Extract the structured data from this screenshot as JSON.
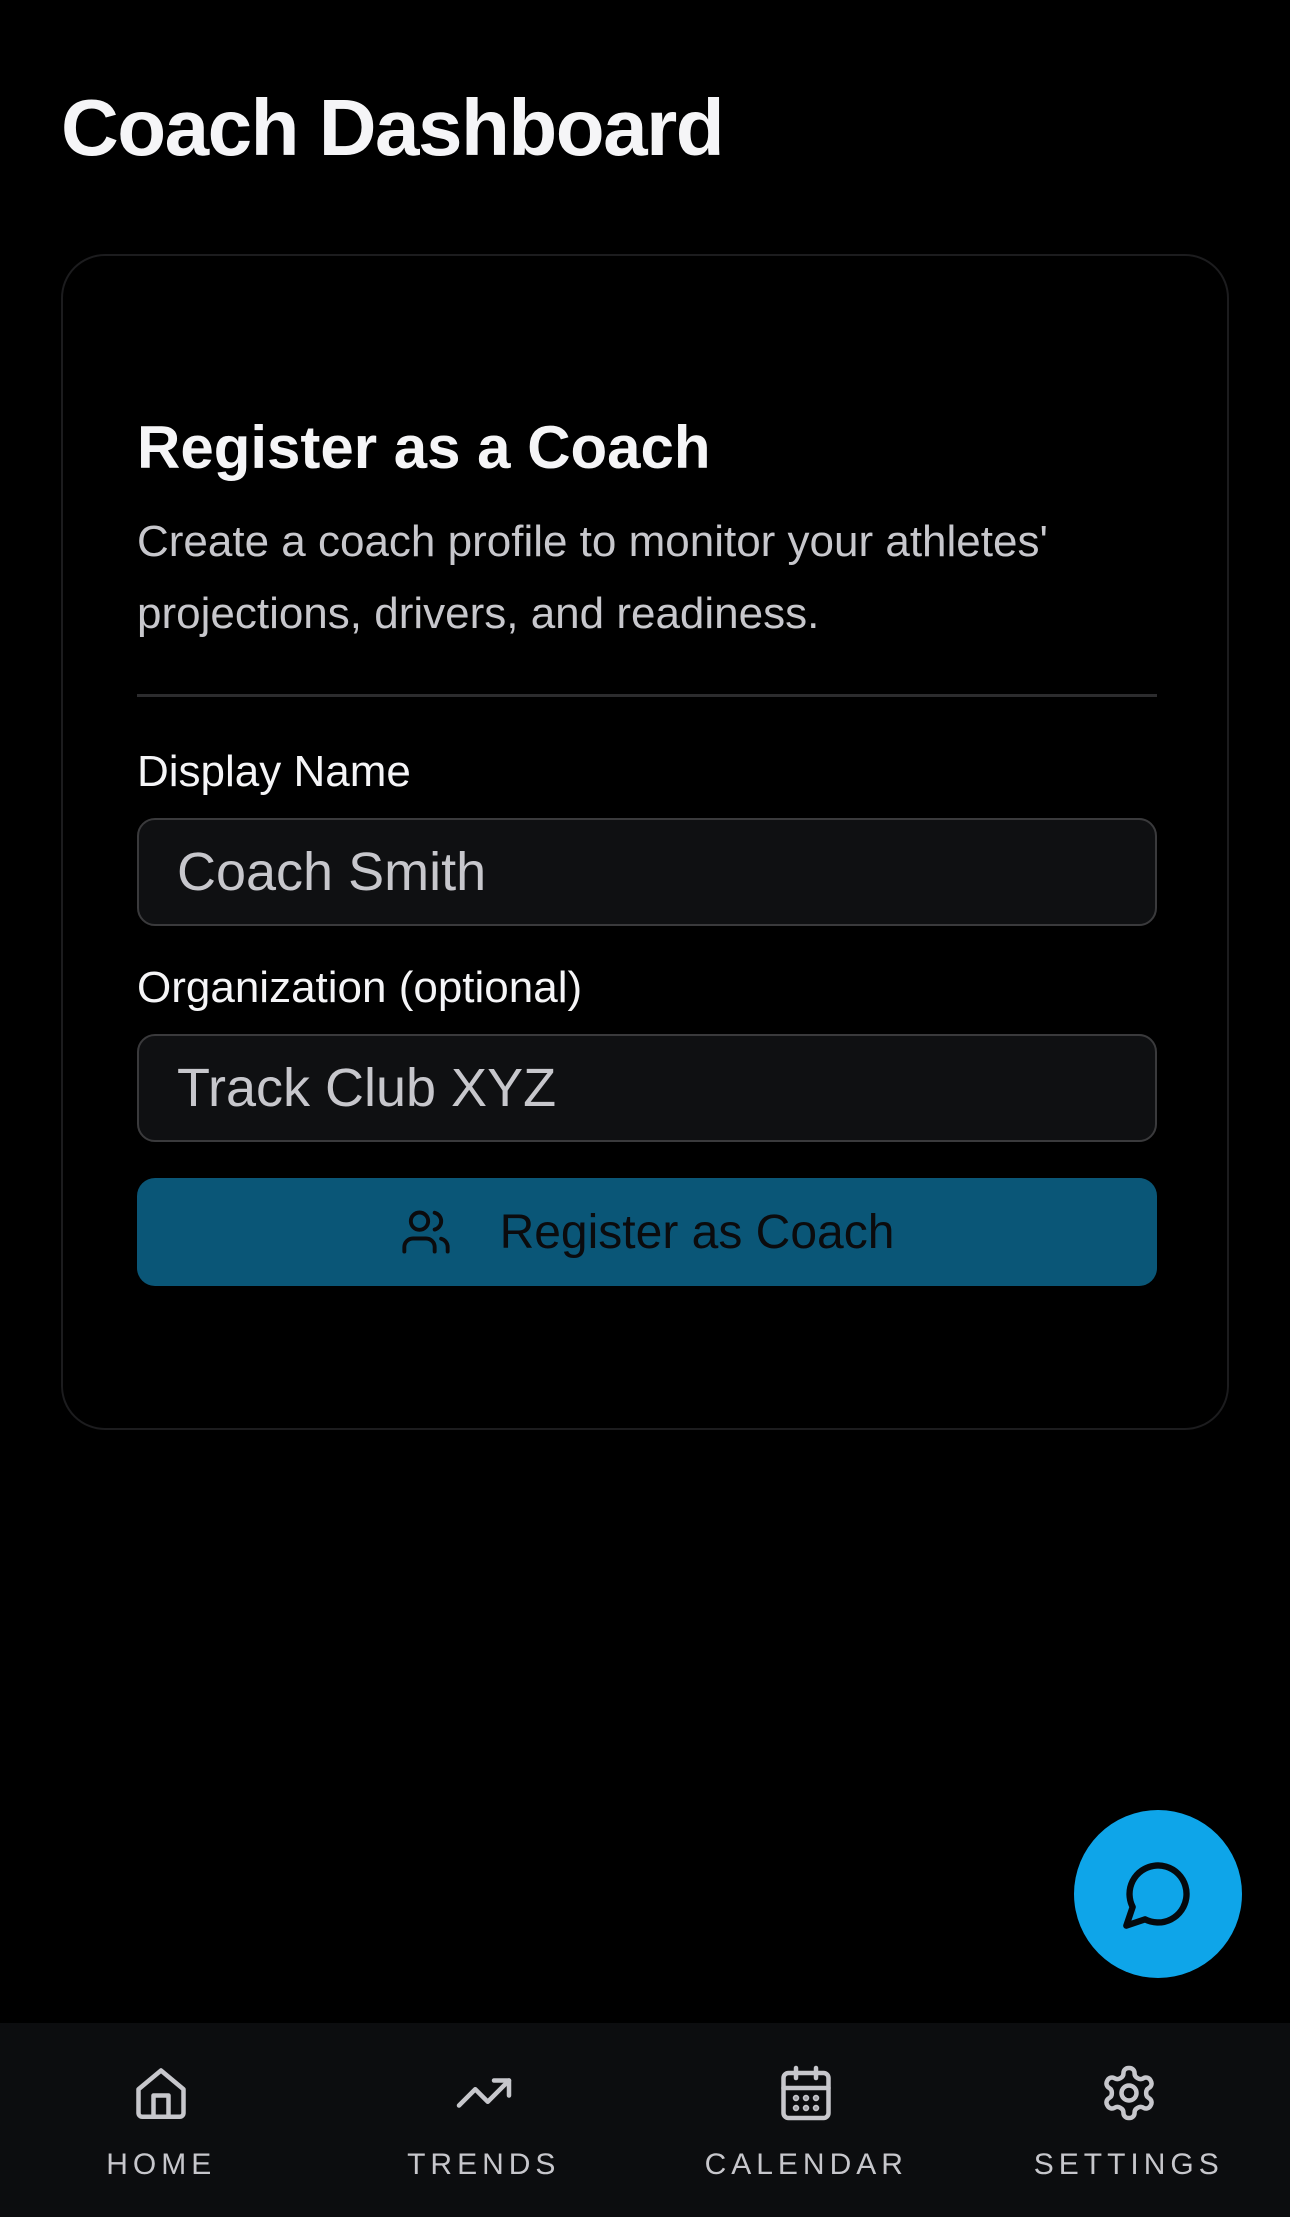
{
  "header": {
    "title": "Coach Dashboard"
  },
  "register_card": {
    "title": "Register as a Coach",
    "description": "Create a coach profile to monitor your athletes' projections, drivers, and readiness.",
    "display_name": {
      "label": "Display Name",
      "placeholder": "Coach Smith",
      "value": ""
    },
    "organization": {
      "label": "Organization (optional)",
      "placeholder": "Track Club XYZ",
      "value": ""
    },
    "submit": {
      "label": "Register as Coach",
      "icon": "users-icon"
    }
  },
  "fab": {
    "icon": "chat-bubble-icon"
  },
  "bottom_nav": {
    "items": [
      {
        "label": "HOME",
        "icon": "home-icon"
      },
      {
        "label": "TRENDS",
        "icon": "trending-up-icon"
      },
      {
        "label": "CALENDAR",
        "icon": "calendar-icon"
      },
      {
        "label": "SETTINGS",
        "icon": "gear-icon"
      }
    ]
  },
  "colors": {
    "background": "#000000",
    "card_border": "#1c1c1e",
    "input_bg": "#0f1012",
    "primary_button": "#0a5677",
    "fab": "#0ea5e9",
    "nav_bg": "#0c0d0f"
  }
}
